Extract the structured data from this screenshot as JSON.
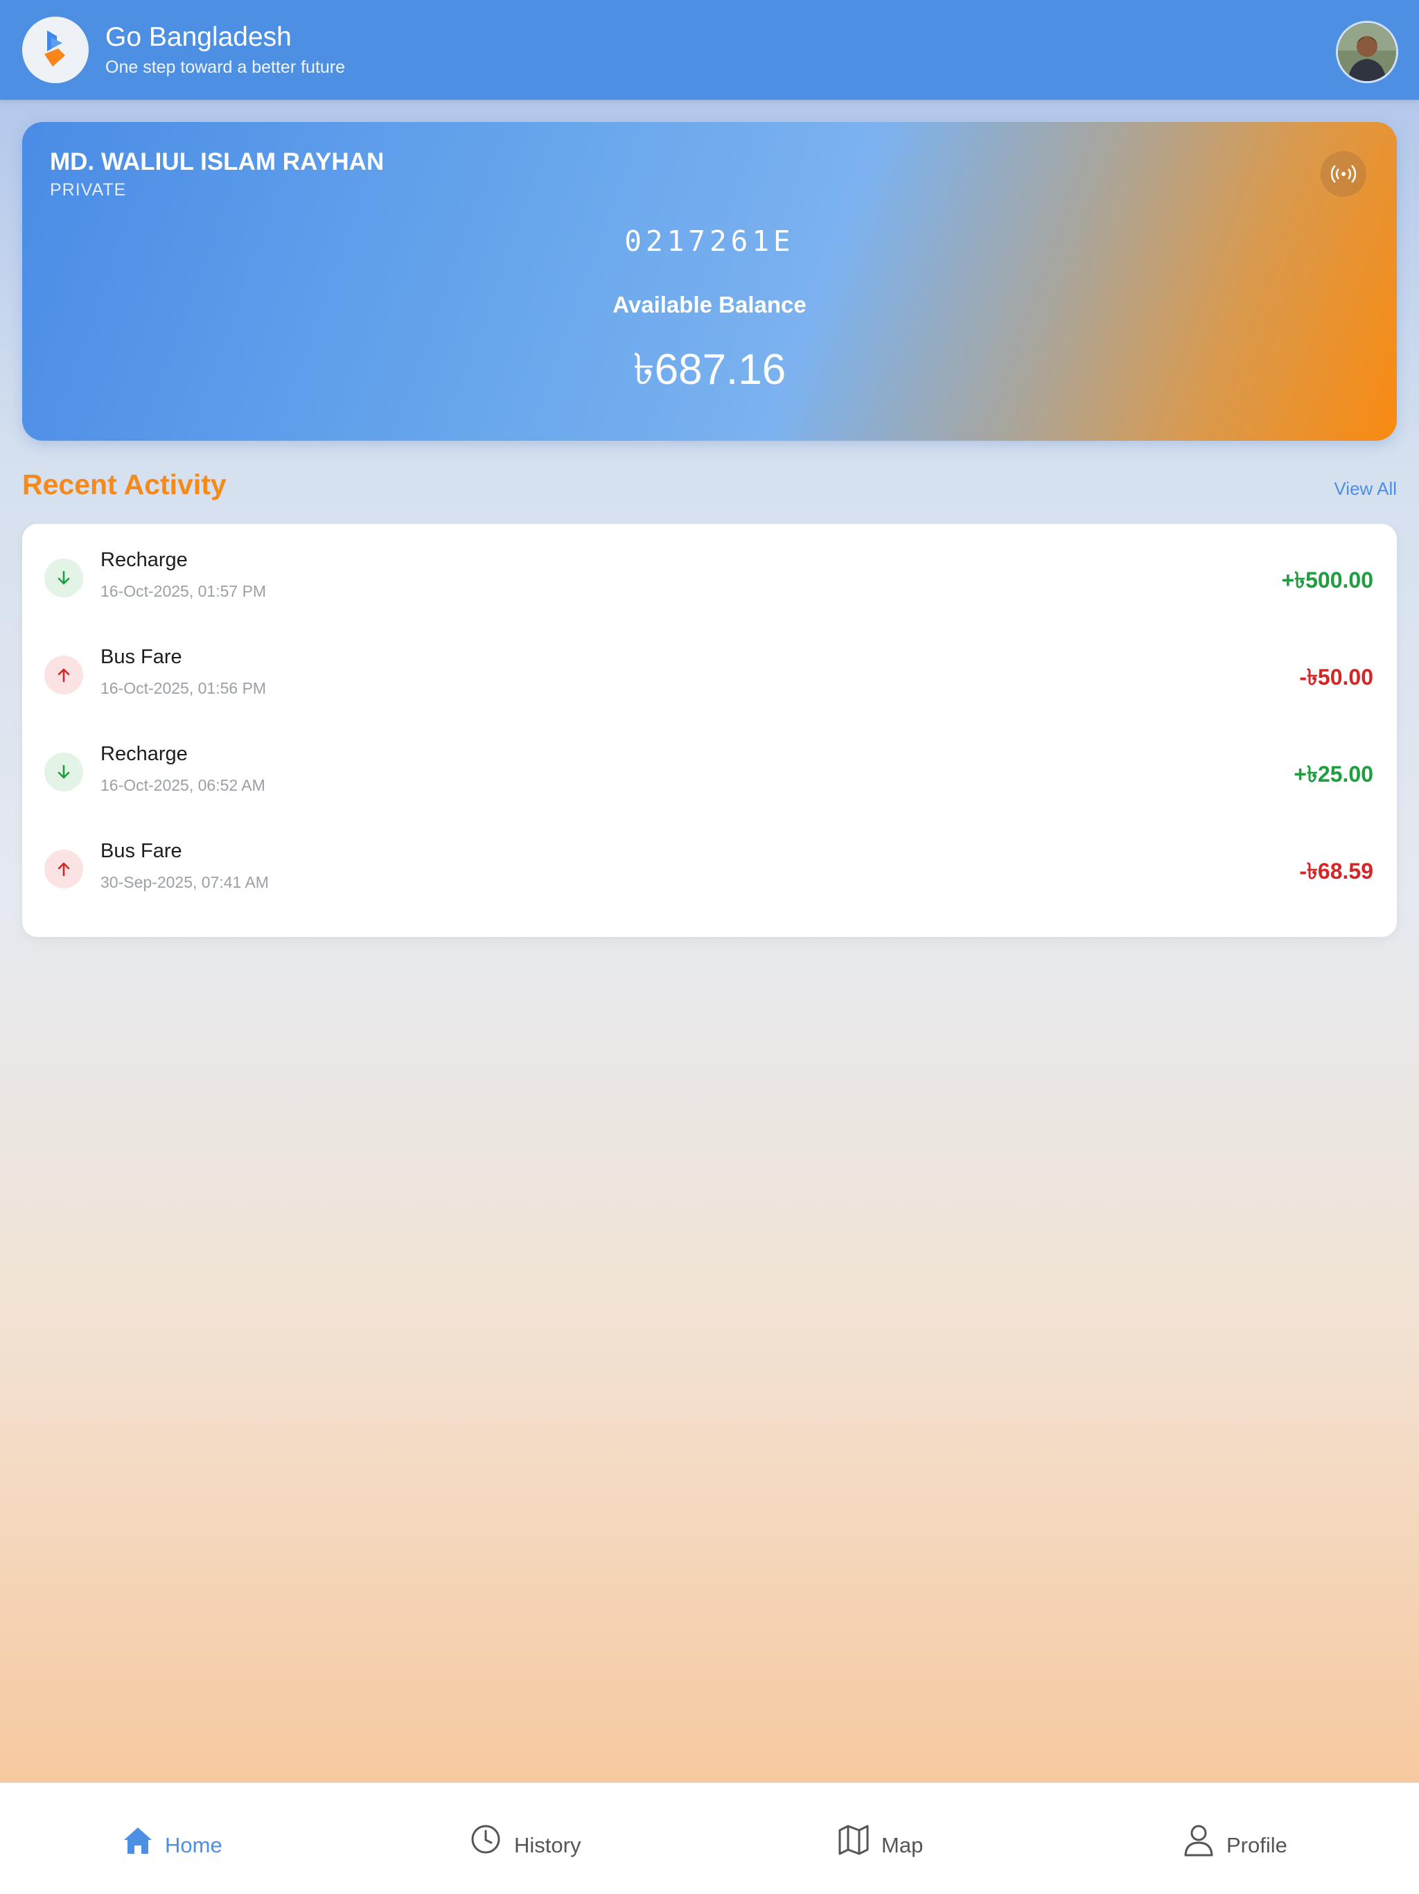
{
  "header": {
    "title": "Go Bangladesh",
    "subtitle": "One step toward a better future"
  },
  "card": {
    "holder_name": "MD. WALIUL ISLAM RAYHAN",
    "holder_type": "PRIVATE",
    "card_number": "0217261E",
    "balance_label": "Available Balance",
    "balance": "৳687.16"
  },
  "activity": {
    "title": "Recent Activity",
    "view_all": "View All",
    "items": [
      {
        "type": "in",
        "label": "Recharge",
        "time": "16-Oct-2025, 01:57 PM",
        "amount": "+৳500.00"
      },
      {
        "type": "out",
        "label": "Bus Fare",
        "time": "16-Oct-2025, 01:56 PM",
        "amount": "-৳50.00"
      },
      {
        "type": "in",
        "label": "Recharge",
        "time": "16-Oct-2025, 06:52 AM",
        "amount": "+৳25.00"
      },
      {
        "type": "out",
        "label": "Bus Fare",
        "time": "30-Sep-2025, 07:41 AM",
        "amount": "-৳68.59"
      }
    ]
  },
  "nav": {
    "home": "Home",
    "history": "History",
    "map": "Map",
    "profile": "Profile"
  },
  "colors": {
    "primary": "#4d8fe3",
    "accent": "#f4891c",
    "credit": "#1f9d3f",
    "debit": "#d32626"
  },
  "icons": {
    "credit": "arrow-down-icon",
    "debit": "arrow-up-icon",
    "nfc": "nfc-icon",
    "home": "home-icon",
    "history": "clock-icon",
    "map": "map-icon",
    "profile": "user-icon"
  }
}
